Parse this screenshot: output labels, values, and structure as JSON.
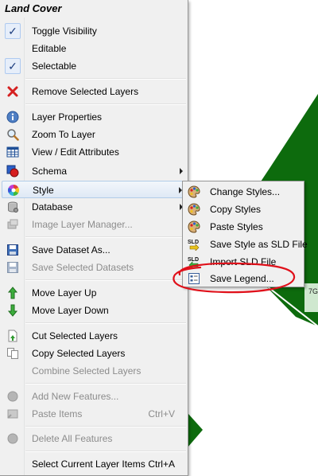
{
  "menu": {
    "title": "Land Cover",
    "items": [
      {
        "label": "Toggle Visibility",
        "icon": "check-icon",
        "checked": true
      },
      {
        "label": "Editable",
        "checked": false
      },
      {
        "label": "Selectable",
        "icon": "check-icon",
        "checked": true
      },
      {
        "label": "Remove Selected Layers",
        "icon": "red-x-icon"
      },
      {
        "label": "Layer Properties",
        "icon": "info-icon"
      },
      {
        "label": "Zoom To Layer",
        "icon": "magnifier-icon"
      },
      {
        "label": "View / Edit Attributes",
        "icon": "table-icon"
      },
      {
        "label": "Schema",
        "icon": "schema-icon",
        "submenu": true
      },
      {
        "label": "Style",
        "icon": "color-wheel-icon",
        "submenu": true,
        "highlighted": true
      },
      {
        "label": "Database",
        "icon": "database-icon",
        "submenu": true
      },
      {
        "label": "Image Layer Manager...",
        "icon": "image-layer-icon",
        "disabled": true
      },
      {
        "label": "Save Dataset As...",
        "icon": "save-icon"
      },
      {
        "label": "Save Selected Datasets",
        "icon": "save-icon",
        "disabled": true
      },
      {
        "label": "Move Layer Up",
        "icon": "arrow-up-icon"
      },
      {
        "label": "Move Layer Down",
        "icon": "arrow-down-icon"
      },
      {
        "label": "Cut Selected Layers",
        "icon": "cut-icon"
      },
      {
        "label": "Copy Selected Layers",
        "icon": "copy-icon"
      },
      {
        "label": "Combine Selected Layers",
        "disabled": true
      },
      {
        "label": "Add New Features...",
        "icon": "circle-icon",
        "disabled": true
      },
      {
        "label": "Paste Items",
        "shortcut": "Ctrl+V",
        "icon": "paste-icon",
        "disabled": true
      },
      {
        "label": "Delete All Features",
        "icon": "circle-icon",
        "disabled": true
      },
      {
        "label": "Select Current Layer Items",
        "shortcut": "Ctrl+A"
      }
    ]
  },
  "style_submenu": {
    "items": [
      {
        "label": "Change Styles...",
        "icon": "palette-icon"
      },
      {
        "label": "Copy Styles",
        "icon": "palette-icon"
      },
      {
        "label": "Paste Styles",
        "icon": "palette-icon"
      },
      {
        "label": "Save Style as SLD File",
        "icon": "sld-save-icon",
        "icon_text": "SLD"
      },
      {
        "label": "Import SLD File",
        "icon": "sld-import-icon",
        "icon_text": "SLD"
      },
      {
        "label": "Save Legend...",
        "icon": "legend-icon",
        "circled": true
      }
    ]
  },
  "colors": {
    "map_green": "#0d6b0d",
    "annotation_red": "#e0101a",
    "highlight": "#dfe9f5"
  },
  "map": {
    "label_fragment": "7G"
  }
}
